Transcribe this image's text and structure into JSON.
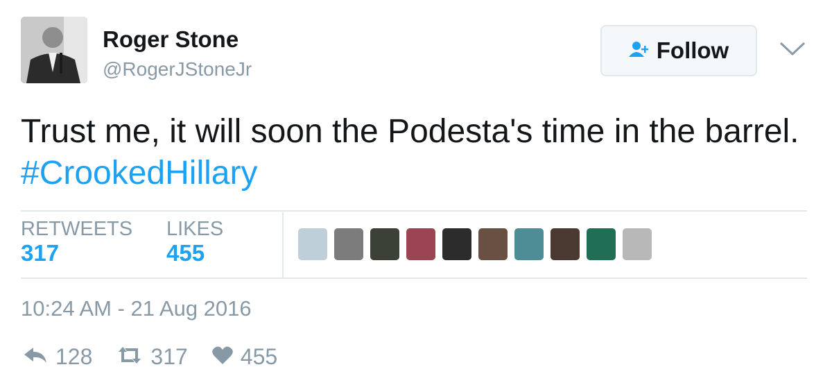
{
  "user": {
    "display_name": "Roger Stone",
    "handle": "@RogerJStoneJr"
  },
  "follow_button": {
    "label": "Follow",
    "icon": "follow-person-icon"
  },
  "tweet": {
    "text": "Trust me, it will soon the Podesta's time in the barrel.",
    "hashtag": "#CrookedHillary"
  },
  "stats": {
    "retweets_label": "RETWEETS",
    "retweets_value": "317",
    "likes_label": "LIKES",
    "likes_value": "455"
  },
  "likers": [
    {
      "name": "free-banner-avatar",
      "color": "#bfcfda"
    },
    {
      "name": "bw-portrait-avatar",
      "color": "#7c7c7c"
    },
    {
      "name": "dark-figure-avatar",
      "color": "#3c4137"
    },
    {
      "name": "red-poster-avatar",
      "color": "#9b4452"
    },
    {
      "name": "sunglasses-avatar",
      "color": "#2c2c2c"
    },
    {
      "name": "brown-group-avatar",
      "color": "#6a4f43"
    },
    {
      "name": "teal-logo-avatar",
      "color": "#4f8d96"
    },
    {
      "name": "dark-photo-avatar",
      "color": "#4a3a32"
    },
    {
      "name": "green-figure-avatar",
      "color": "#1f6e55"
    },
    {
      "name": "grey-portrait-avatar",
      "color": "#b8b8b8"
    }
  ],
  "timestamp": "10:24 AM - 21 Aug 2016",
  "actions": {
    "reply_count": "128",
    "retweet_count": "317",
    "like_count": "455"
  },
  "colors": {
    "accent": "#1da1f2",
    "muted": "#8899a6",
    "border": "#e1e8ed"
  }
}
